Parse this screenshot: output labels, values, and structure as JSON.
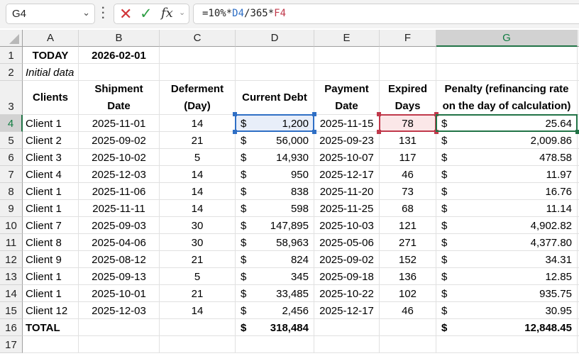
{
  "formula_bar": {
    "name_box": "G4",
    "cancel_icon": "✕",
    "enter_icon": "✓",
    "fx_label": "fx",
    "formula_parts": {
      "prefix": "=10%*",
      "ref1": "D4",
      "mid": "/365*",
      "ref2": "F4"
    }
  },
  "columns": [
    "A",
    "B",
    "C",
    "D",
    "E",
    "F",
    "G"
  ],
  "active_column": "G",
  "active_row": "4",
  "row_numbers": [
    "1",
    "2",
    "3",
    "4",
    "5",
    "6",
    "7",
    "8",
    "9",
    "10",
    "11",
    "12",
    "13",
    "14",
    "15",
    "16",
    "17"
  ],
  "sheet": {
    "today_label": "TODAY",
    "today_value": "2026-02-01",
    "initial_data_label": "Initial data",
    "headers": {
      "clients": "Clients",
      "shipment_date_1": "Shipment",
      "shipment_date_2": "Date",
      "deferment_1": "Deferment",
      "deferment_2": "(Day)",
      "current_debt": "Current Debt",
      "payment_date_1": "Payment",
      "payment_date_2": "Date",
      "expired_days_1": "Expired",
      "expired_days_2": "Days",
      "penalty_1": "Penalty (refinancing rate",
      "penalty_2": "on the day of calculation)"
    },
    "currency_symbol": "$",
    "rows": [
      {
        "client": "Client 1",
        "shipment": "2025-11-01",
        "deferment": "14",
        "debt": "1,200",
        "payment": "2025-11-15",
        "expired": "78",
        "penalty": "25.64"
      },
      {
        "client": "Client 2",
        "shipment": "2025-09-02",
        "deferment": "21",
        "debt": "56,000",
        "payment": "2025-09-23",
        "expired": "131",
        "penalty": "2,009.86"
      },
      {
        "client": "Client 3",
        "shipment": "2025-10-02",
        "deferment": "5",
        "debt": "14,930",
        "payment": "2025-10-07",
        "expired": "117",
        "penalty": "478.58"
      },
      {
        "client": "Client 4",
        "shipment": "2025-12-03",
        "deferment": "14",
        "debt": "950",
        "payment": "2025-12-17",
        "expired": "46",
        "penalty": "11.97"
      },
      {
        "client": "Client 1",
        "shipment": "2025-11-06",
        "deferment": "14",
        "debt": "838",
        "payment": "2025-11-20",
        "expired": "73",
        "penalty": "16.76"
      },
      {
        "client": "Client 1",
        "shipment": "2025-11-11",
        "deferment": "14",
        "debt": "598",
        "payment": "2025-11-25",
        "expired": "68",
        "penalty": "11.14"
      },
      {
        "client": "Client 7",
        "shipment": "2025-09-03",
        "deferment": "30",
        "debt": "147,895",
        "payment": "2025-10-03",
        "expired": "121",
        "penalty": "4,902.82"
      },
      {
        "client": "Client 8",
        "shipment": "2025-04-06",
        "deferment": "30",
        "debt": "58,963",
        "payment": "2025-05-06",
        "expired": "271",
        "penalty": "4,377.80"
      },
      {
        "client": "Client 9",
        "shipment": "2025-08-12",
        "deferment": "21",
        "debt": "824",
        "payment": "2025-09-02",
        "expired": "152",
        "penalty": "34.31"
      },
      {
        "client": "Client 1",
        "shipment": "2025-09-13",
        "deferment": "5",
        "debt": "345",
        "payment": "2025-09-18",
        "expired": "136",
        "penalty": "12.85"
      },
      {
        "client": "Client 1",
        "shipment": "2025-10-01",
        "deferment": "21",
        "debt": "33,485",
        "payment": "2025-10-22",
        "expired": "102",
        "penalty": "935.75"
      },
      {
        "client": "Client 12",
        "shipment": "2025-12-03",
        "deferment": "14",
        "debt": "2,456",
        "payment": "2025-12-17",
        "expired": "46",
        "penalty": "30.95"
      }
    ],
    "total_label": "TOTAL",
    "total_debt": "318,484",
    "total_penalty": "12,848.45"
  },
  "colors": {
    "active_accent": "#217346",
    "ref_blue": "#2f6fc5",
    "ref_red": "#c0394b",
    "cancel_red": "#d13438",
    "enter_green": "#2e9e44"
  }
}
